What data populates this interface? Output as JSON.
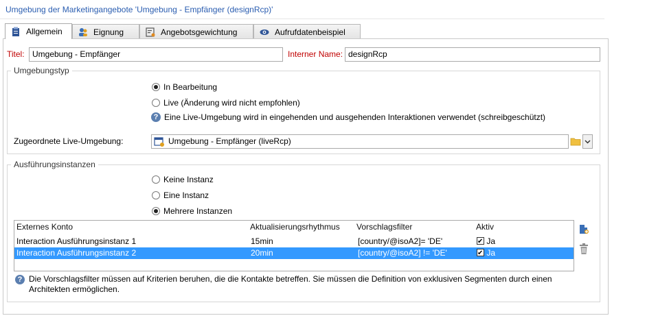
{
  "window": {
    "title": "Umgebung der Marketingangebote 'Umgebung - Empfänger (designRcp)'"
  },
  "tabs": [
    {
      "label": "Allgemein",
      "icon": "clipboard-icon"
    },
    {
      "label": "Eignung",
      "icon": "users-icon"
    },
    {
      "label": "Angebotsgewichtung",
      "icon": "weighting-icon"
    },
    {
      "label": "Aufrufdatenbeispiel",
      "icon": "eye-icon"
    }
  ],
  "general": {
    "title_label": "Titel:",
    "title_value": "Umgebung - Empfänger",
    "internal_name_label": "Interner Name:",
    "internal_name_value": "designRcp"
  },
  "env_type": {
    "group_label": "Umgebungstyp",
    "options": [
      {
        "label": "In Bearbeitung",
        "selected": true
      },
      {
        "label": "Live (Änderung wird nicht empfohlen)",
        "selected": false
      }
    ],
    "help_text": "Eine Live-Umgebung wird in eingehenden und ausgehenden Interaktionen verwendet (schreibgeschützt)",
    "live_env_label": "Zugeordnete Live-Umgebung:",
    "live_env_value": "Umgebung - Empfänger (liveRcp)"
  },
  "instances": {
    "group_label": "Ausführungsinstanzen",
    "options": [
      {
        "label": "Keine Instanz",
        "selected": false
      },
      {
        "label": "Eine Instanz",
        "selected": false
      },
      {
        "label": "Mehrere Instanzen",
        "selected": true
      }
    ],
    "columns": [
      "Externes Konto",
      "Aktualisierungsrhythmus",
      "Vorschlagsfilter",
      "Aktiv"
    ],
    "rows": [
      {
        "account": "Interaction Ausführungsinstanz 1",
        "rhythm": "15min",
        "filter": "[country/@isoA2]= 'DE'",
        "active": "Ja",
        "selected": false
      },
      {
        "account": "Interaction Ausführungsinstanz 2",
        "rhythm": "20min",
        "filter": "[country/@isoA2] != 'DE'",
        "active": "Ja",
        "selected": true
      }
    ],
    "help_text": "Die Vorschlagsfilter müssen auf Kriterien beruhen, die die Kontakte betreffen. Sie müssen die Definition von exklusiven Segmenten durch einen Architekten ermöglichen."
  },
  "colors": {
    "title_blue": "#2a5db0",
    "required_red": "#c00000",
    "selection_blue": "#3399ff"
  }
}
